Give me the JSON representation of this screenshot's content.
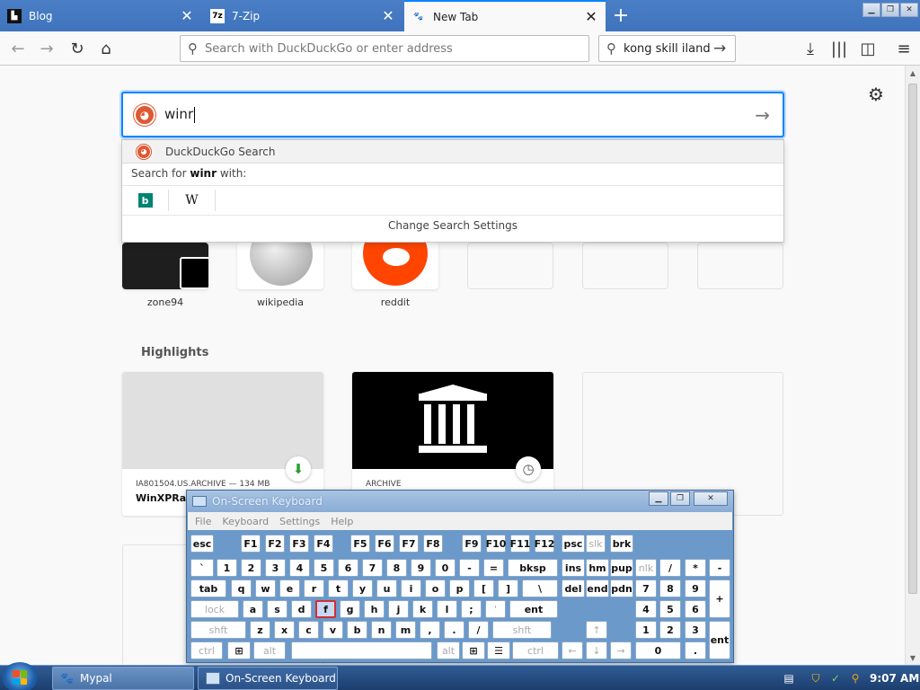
{
  "tabs": [
    {
      "title": "Blog",
      "active": false
    },
    {
      "title": "7-Zip",
      "favicon_text": "7z",
      "active": false
    },
    {
      "title": "New Tab",
      "active": true
    }
  ],
  "toolbar": {
    "url_placeholder": "Search with DuckDuckGo or enter address",
    "search_value": "kong skill iland"
  },
  "hero_search": {
    "value": "winr",
    "suggestion_engine": "DuckDuckGo Search",
    "search_for_prefix": "Search for ",
    "search_for_term": "winr",
    "search_for_suffix": " with:",
    "engines": [
      "bing-icon",
      "wikipedia-icon"
    ],
    "bing_letter": "b",
    "wiki_letter": "W",
    "change_settings": "Change Search Settings"
  },
  "top_sites": [
    {
      "label": "zone94"
    },
    {
      "label": "wikipedia"
    },
    {
      "label": "reddit"
    }
  ],
  "highlights": {
    "title": "Highlights",
    "cards": [
      {
        "context": "IA801504.US.ARCHIVE — 134 MB",
        "title": "WinXPRar",
        "badge_icon": "download-icon"
      },
      {
        "context": "ARCHIVE",
        "title": "",
        "badge_icon": "clock-icon"
      }
    ]
  },
  "osk": {
    "title": "On-Screen Keyboard",
    "menu": [
      "File",
      "Keyboard",
      "Settings",
      "Help"
    ],
    "highlighted_key": "f",
    "rows": [
      [
        "esc",
        "F1",
        "F2",
        "F3",
        "F4",
        "F5",
        "F6",
        "F7",
        "F8",
        "F9",
        "F10",
        "F11",
        "F12",
        "psc",
        "slk",
        "brk"
      ],
      [
        "`",
        "1",
        "2",
        "3",
        "4",
        "5",
        "6",
        "7",
        "8",
        "9",
        "0",
        "-",
        "=",
        "bksp",
        "ins",
        "hm",
        "pup",
        "nlk",
        "/",
        "*",
        "-"
      ],
      [
        "tab",
        "q",
        "w",
        "e",
        "r",
        "t",
        "y",
        "u",
        "i",
        "o",
        "p",
        "[",
        "]",
        "\\",
        "del",
        "end",
        "pdn",
        "7",
        "8",
        "9",
        "+"
      ],
      [
        "lock",
        "a",
        "s",
        "d",
        "f",
        "g",
        "h",
        "j",
        "k",
        "l",
        ";",
        "'",
        "ent",
        "4",
        "5",
        "6"
      ],
      [
        "shft",
        "z",
        "x",
        "c",
        "v",
        "b",
        "n",
        "m",
        ",",
        ".",
        "/",
        "shft",
        "↑",
        "1",
        "2",
        "3",
        "ent"
      ],
      [
        "ctrl",
        "⊞",
        "alt",
        "alt",
        "⊞",
        "☰",
        "ctrl",
        "←",
        "↓",
        "→",
        "0",
        "."
      ]
    ]
  },
  "taskbar": {
    "buttons": [
      {
        "label": "Mypal",
        "active": true
      },
      {
        "label": "On-Screen Keyboard",
        "active": false
      }
    ],
    "clock": "9:07 AM"
  },
  "colors": {
    "tabstrip": "#4a7fc6",
    "focus_ring": "#0a84ff",
    "duckduckgo": "#de5833",
    "reddit": "#ff4500",
    "osk_bg": "#6b99c9",
    "taskbar": "#1c3e6d"
  }
}
